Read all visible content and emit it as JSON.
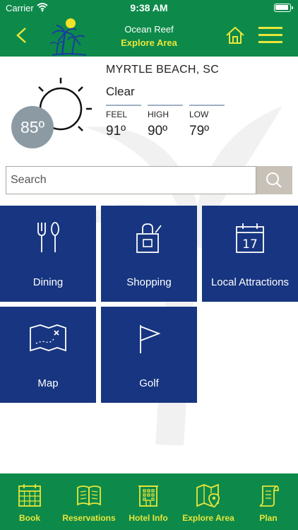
{
  "status_bar": {
    "carrier": "Carrier",
    "time": "9:38 AM"
  },
  "header": {
    "title_top": "Ocean Reef",
    "title_main": "Explore Area",
    "icons": [
      "back-arrow-icon",
      "palm-tree-logo",
      "home-icon",
      "hamburger-menu-icon"
    ]
  },
  "weather": {
    "location": "MYRTLE BEACH, SC",
    "condition": "Clear",
    "current_temp": "85º",
    "stats": [
      {
        "label": "FEEL",
        "value": "91º"
      },
      {
        "label": "HIGH",
        "value": "90º"
      },
      {
        "label": "LOW",
        "value": "79º"
      }
    ]
  },
  "search": {
    "placeholder": "Search"
  },
  "tiles": [
    {
      "label": "Dining",
      "icon": "fork-knife-icon"
    },
    {
      "label": "Shopping",
      "icon": "shopping-bag-icon"
    },
    {
      "label": "Local Attractions",
      "icon": "calendar-icon"
    },
    {
      "label": "Map",
      "icon": "treasure-map-icon"
    },
    {
      "label": "Golf",
      "icon": "golf-flag-icon"
    }
  ],
  "tab_bar": [
    {
      "label": "Book",
      "icon": "calendar-grid-icon"
    },
    {
      "label": "Reservations",
      "icon": "open-book-icon"
    },
    {
      "label": "Hotel Info",
      "icon": "hotel-building-icon"
    },
    {
      "label": "Explore Area",
      "icon": "map-pin-icon"
    },
    {
      "label": "Plan",
      "icon": "scroll-icon"
    }
  ],
  "colors": {
    "primary_green": "#0d8a4a",
    "accent_yellow": "#e8e63a",
    "tile_blue": "#173580",
    "temp_circle": "#8c9aa4",
    "search_button": "#c7c1b8"
  }
}
